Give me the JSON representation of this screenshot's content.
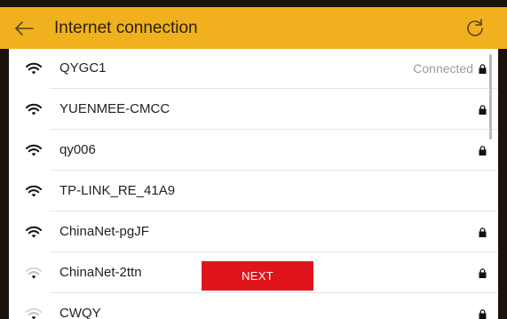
{
  "header": {
    "title": "Internet connection",
    "back_icon": "back-arrow-icon",
    "refresh_icon": "refresh-icon",
    "background": "#f1b11f"
  },
  "networks": [
    {
      "ssid": "QYGC1",
      "status": "Connected",
      "locked": true,
      "signal": "strong"
    },
    {
      "ssid": "YUENMEE-CMCC",
      "status": "",
      "locked": true,
      "signal": "strong"
    },
    {
      "ssid": "qy006",
      "status": "",
      "locked": true,
      "signal": "strong"
    },
    {
      "ssid": "TP-LINK_RE_41A9",
      "status": "",
      "locked": false,
      "signal": "strong"
    },
    {
      "ssid": "ChinaNet-pgJF",
      "status": "",
      "locked": true,
      "signal": "strong"
    },
    {
      "ssid": "ChinaNet-2ttn",
      "status": "",
      "locked": true,
      "signal": "weak"
    },
    {
      "ssid": "CWQY",
      "status": "",
      "locked": true,
      "signal": "weak"
    }
  ],
  "next_button": {
    "label": "NEXT",
    "color": "#e0151b"
  }
}
